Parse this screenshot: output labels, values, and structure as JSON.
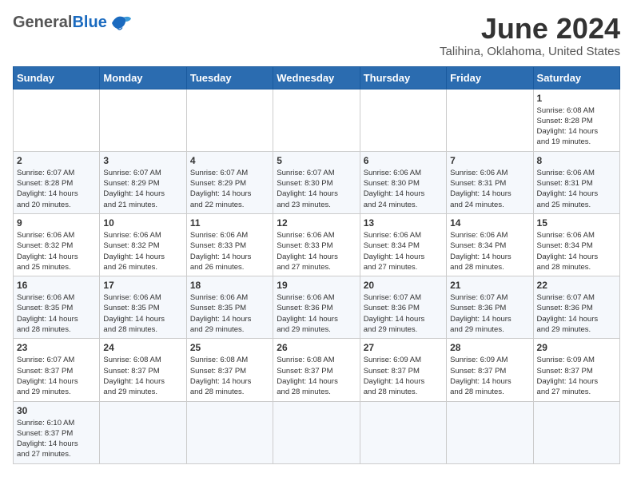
{
  "header": {
    "logo_general": "General",
    "logo_blue": "Blue",
    "month": "June 2024",
    "location": "Talihina, Oklahoma, United States"
  },
  "days_of_week": [
    "Sunday",
    "Monday",
    "Tuesday",
    "Wednesday",
    "Thursday",
    "Friday",
    "Saturday"
  ],
  "weeks": [
    [
      {
        "day": "",
        "content": ""
      },
      {
        "day": "",
        "content": ""
      },
      {
        "day": "",
        "content": ""
      },
      {
        "day": "",
        "content": ""
      },
      {
        "day": "",
        "content": ""
      },
      {
        "day": "",
        "content": ""
      },
      {
        "day": "1",
        "content": "Sunrise: 6:08 AM\nSunset: 8:28 PM\nDaylight: 14 hours\nand 19 minutes."
      }
    ],
    [
      {
        "day": "2",
        "content": "Sunrise: 6:07 AM\nSunset: 8:28 PM\nDaylight: 14 hours\nand 20 minutes."
      },
      {
        "day": "3",
        "content": "Sunrise: 6:07 AM\nSunset: 8:29 PM\nDaylight: 14 hours\nand 21 minutes."
      },
      {
        "day": "4",
        "content": "Sunrise: 6:07 AM\nSunset: 8:29 PM\nDaylight: 14 hours\nand 22 minutes."
      },
      {
        "day": "5",
        "content": "Sunrise: 6:07 AM\nSunset: 8:30 PM\nDaylight: 14 hours\nand 23 minutes."
      },
      {
        "day": "6",
        "content": "Sunrise: 6:06 AM\nSunset: 8:30 PM\nDaylight: 14 hours\nand 24 minutes."
      },
      {
        "day": "7",
        "content": "Sunrise: 6:06 AM\nSunset: 8:31 PM\nDaylight: 14 hours\nand 24 minutes."
      },
      {
        "day": "8",
        "content": "Sunrise: 6:06 AM\nSunset: 8:31 PM\nDaylight: 14 hours\nand 25 minutes."
      }
    ],
    [
      {
        "day": "9",
        "content": "Sunrise: 6:06 AM\nSunset: 8:32 PM\nDaylight: 14 hours\nand 25 minutes."
      },
      {
        "day": "10",
        "content": "Sunrise: 6:06 AM\nSunset: 8:32 PM\nDaylight: 14 hours\nand 26 minutes."
      },
      {
        "day": "11",
        "content": "Sunrise: 6:06 AM\nSunset: 8:33 PM\nDaylight: 14 hours\nand 26 minutes."
      },
      {
        "day": "12",
        "content": "Sunrise: 6:06 AM\nSunset: 8:33 PM\nDaylight: 14 hours\nand 27 minutes."
      },
      {
        "day": "13",
        "content": "Sunrise: 6:06 AM\nSunset: 8:34 PM\nDaylight: 14 hours\nand 27 minutes."
      },
      {
        "day": "14",
        "content": "Sunrise: 6:06 AM\nSunset: 8:34 PM\nDaylight: 14 hours\nand 28 minutes."
      },
      {
        "day": "15",
        "content": "Sunrise: 6:06 AM\nSunset: 8:34 PM\nDaylight: 14 hours\nand 28 minutes."
      }
    ],
    [
      {
        "day": "16",
        "content": "Sunrise: 6:06 AM\nSunset: 8:35 PM\nDaylight: 14 hours\nand 28 minutes."
      },
      {
        "day": "17",
        "content": "Sunrise: 6:06 AM\nSunset: 8:35 PM\nDaylight: 14 hours\nand 28 minutes."
      },
      {
        "day": "18",
        "content": "Sunrise: 6:06 AM\nSunset: 8:35 PM\nDaylight: 14 hours\nand 29 minutes."
      },
      {
        "day": "19",
        "content": "Sunrise: 6:06 AM\nSunset: 8:36 PM\nDaylight: 14 hours\nand 29 minutes."
      },
      {
        "day": "20",
        "content": "Sunrise: 6:07 AM\nSunset: 8:36 PM\nDaylight: 14 hours\nand 29 minutes."
      },
      {
        "day": "21",
        "content": "Sunrise: 6:07 AM\nSunset: 8:36 PM\nDaylight: 14 hours\nand 29 minutes."
      },
      {
        "day": "22",
        "content": "Sunrise: 6:07 AM\nSunset: 8:36 PM\nDaylight: 14 hours\nand 29 minutes."
      }
    ],
    [
      {
        "day": "23",
        "content": "Sunrise: 6:07 AM\nSunset: 8:37 PM\nDaylight: 14 hours\nand 29 minutes."
      },
      {
        "day": "24",
        "content": "Sunrise: 6:08 AM\nSunset: 8:37 PM\nDaylight: 14 hours\nand 29 minutes."
      },
      {
        "day": "25",
        "content": "Sunrise: 6:08 AM\nSunset: 8:37 PM\nDaylight: 14 hours\nand 28 minutes."
      },
      {
        "day": "26",
        "content": "Sunrise: 6:08 AM\nSunset: 8:37 PM\nDaylight: 14 hours\nand 28 minutes."
      },
      {
        "day": "27",
        "content": "Sunrise: 6:09 AM\nSunset: 8:37 PM\nDaylight: 14 hours\nand 28 minutes."
      },
      {
        "day": "28",
        "content": "Sunrise: 6:09 AM\nSunset: 8:37 PM\nDaylight: 14 hours\nand 28 minutes."
      },
      {
        "day": "29",
        "content": "Sunrise: 6:09 AM\nSunset: 8:37 PM\nDaylight: 14 hours\nand 27 minutes."
      }
    ],
    [
      {
        "day": "30",
        "content": "Sunrise: 6:10 AM\nSunset: 8:37 PM\nDaylight: 14 hours\nand 27 minutes."
      },
      {
        "day": "",
        "content": ""
      },
      {
        "day": "",
        "content": ""
      },
      {
        "day": "",
        "content": ""
      },
      {
        "day": "",
        "content": ""
      },
      {
        "day": "",
        "content": ""
      },
      {
        "day": "",
        "content": ""
      }
    ]
  ]
}
